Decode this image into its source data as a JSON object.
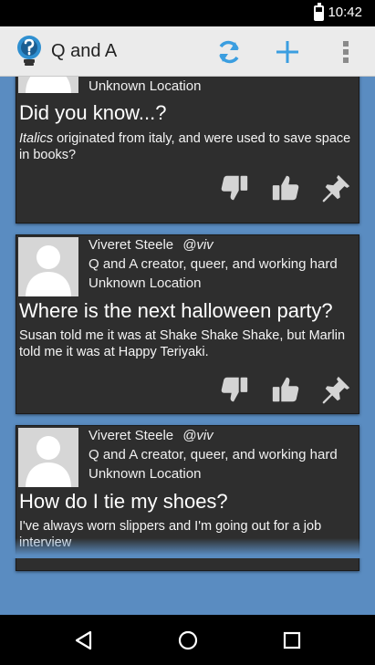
{
  "status_bar": {
    "time": "10:42"
  },
  "app_bar": {
    "title": "Q and A"
  },
  "colors": {
    "background": "#5a8cc1",
    "card": "#2e2e2e",
    "accent": "#2f8fd0",
    "icon_gray": "#d4d4d4"
  },
  "cards": [
    {
      "location": "Unknown Location",
      "title": "Did you know...?",
      "body_italic": "Italics",
      "body": " originated from italy, and were used to save space in books?",
      "actions": [
        "thumbs-down-icon",
        "thumbs-up-icon",
        "pin-icon"
      ]
    },
    {
      "author": "Viveret Steele",
      "handle": "@viv",
      "bio": "Q and A creator, queer, and working hard",
      "location": "Unknown Location",
      "title": "Where is the next halloween party?",
      "body": "Susan told me it was at Shake Shake Shake, but Marlin told me it was at Happy Teriyaki.",
      "actions": [
        "thumbs-down-icon",
        "thumbs-up-icon",
        "pin-icon"
      ]
    },
    {
      "author": "Viveret Steele",
      "handle": "@viv",
      "bio": "Q and A creator, queer, and working hard",
      "location": "Unknown Location",
      "title": "How do I tie my shoes?",
      "body": "I've always worn slippers and I'm going out for a job interview"
    }
  ]
}
